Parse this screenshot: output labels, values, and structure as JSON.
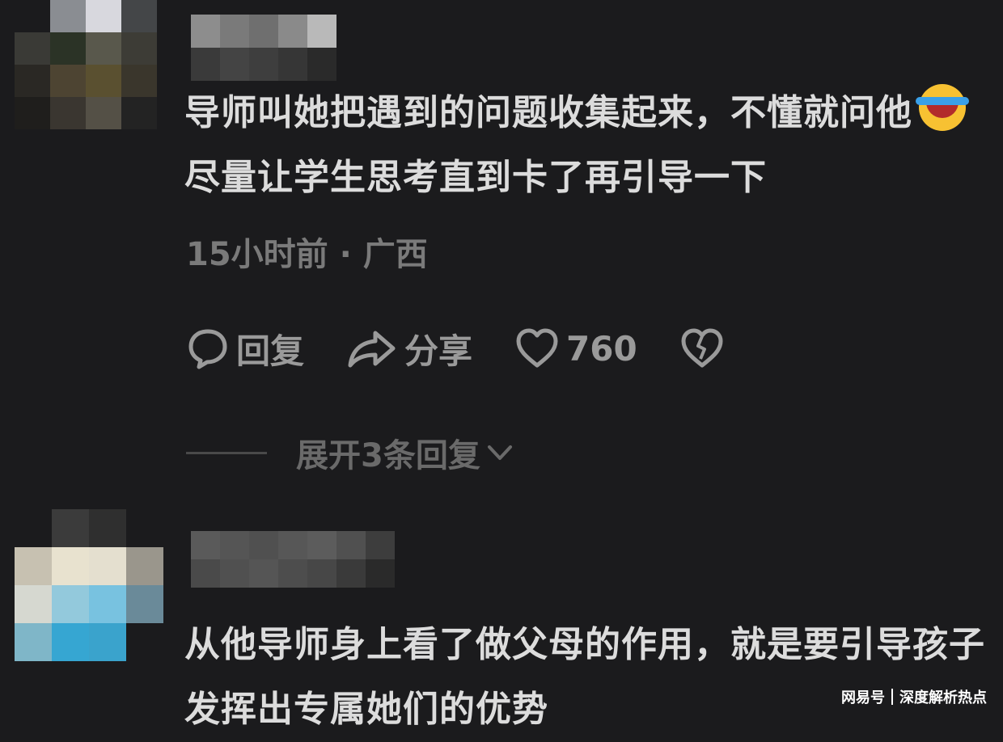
{
  "comments": [
    {
      "text_part1": "导师叫她把遇到的问题收集起来，不懂就问他",
      "emoji": "crying-laughing-emoji",
      "text_part2": "尽量让学生思考直到卡了再引导一下",
      "time": "15小时前",
      "separator": "·",
      "location": "广西",
      "actions": {
        "reply_label": "回复",
        "share_label": "分享",
        "like_count": "760"
      },
      "expand_label": "展开3条回复"
    },
    {
      "text": "从他导师身上看了做父母的作用，就是要引导孩子发挥出专属她们的优势"
    }
  ],
  "watermark": {
    "brand": "网易号",
    "tagline": "深度解析热点"
  },
  "colors": {
    "background": "#1b1b1d",
    "text": "#dcdcdc",
    "meta": "#7a7a7a",
    "action": "#9a9a9a"
  }
}
